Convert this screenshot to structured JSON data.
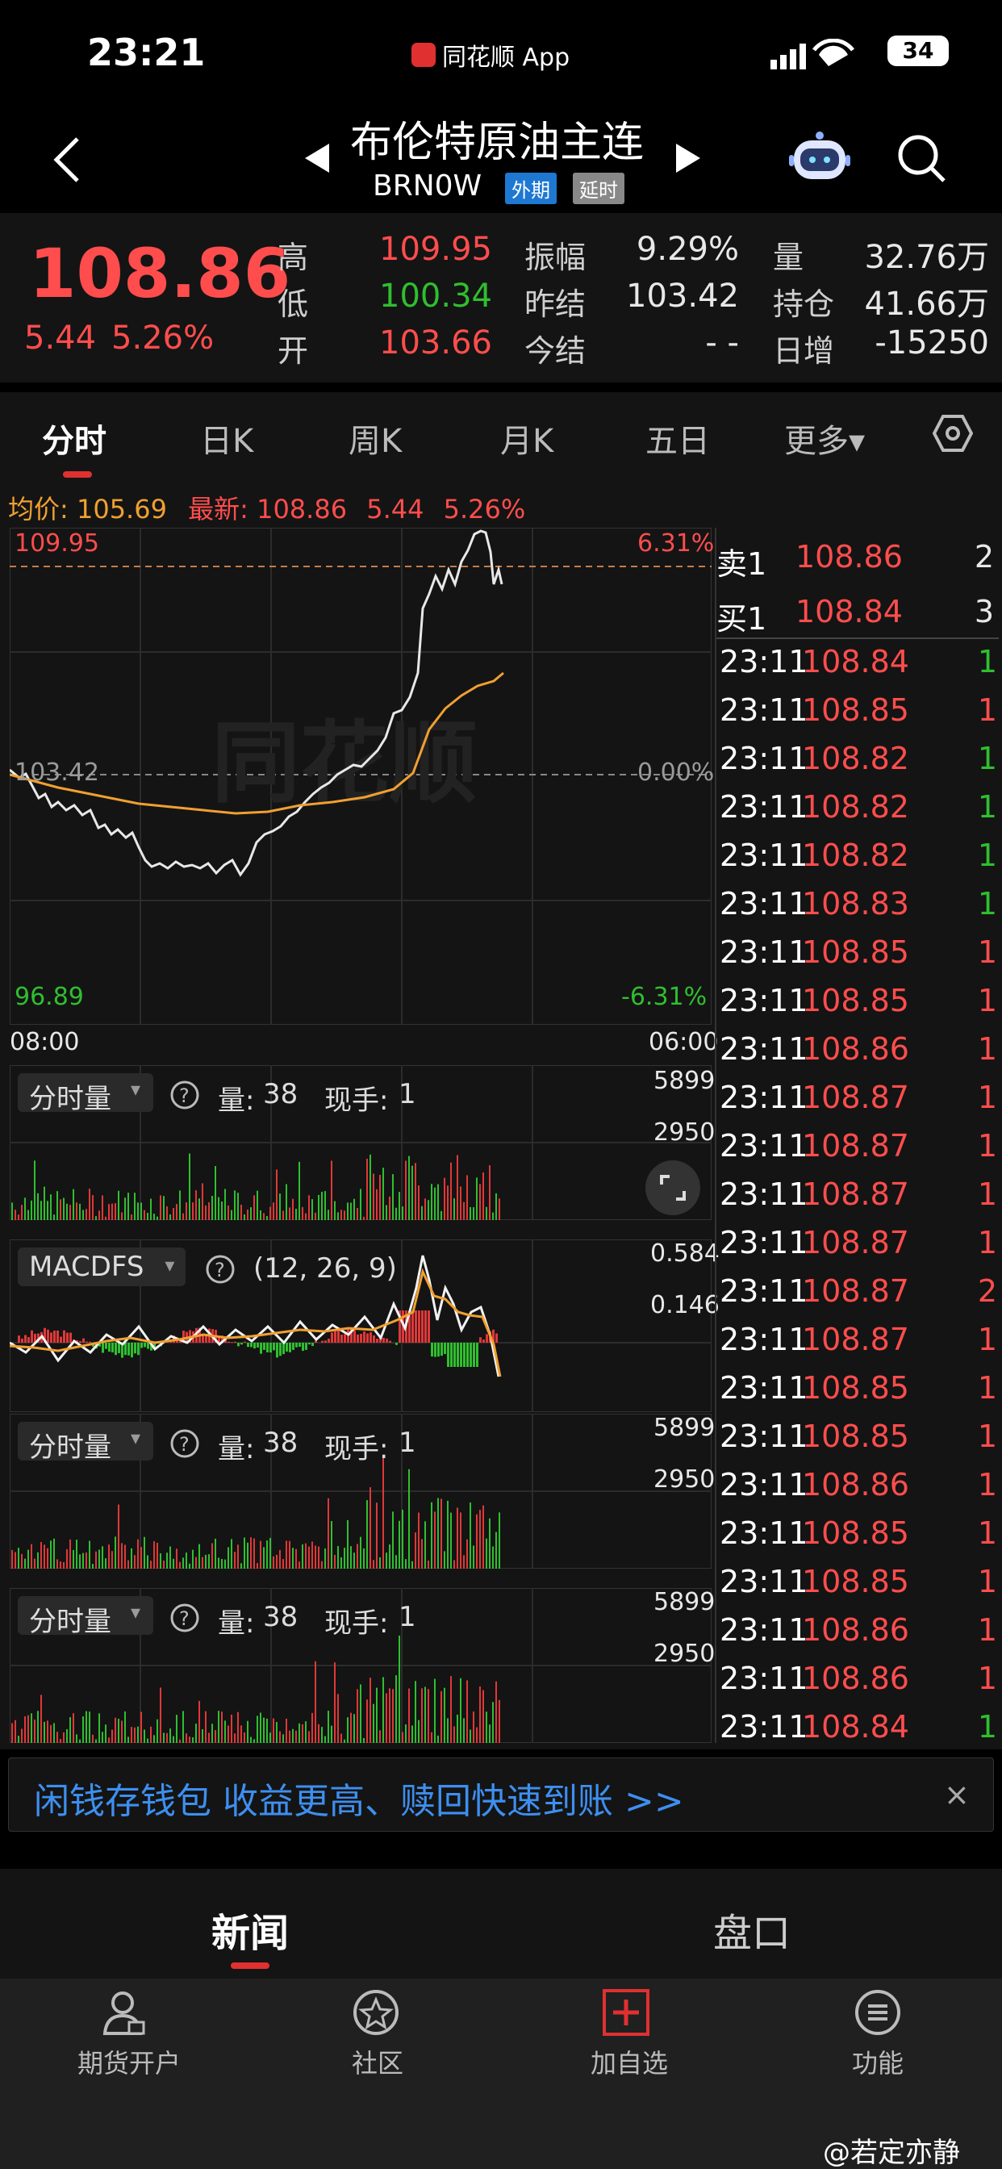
{
  "status_bar": {
    "time": "23:21",
    "app_name": "同花顺 App",
    "battery": "34"
  },
  "header": {
    "title": "布伦特原油主连",
    "code": "BRN0W",
    "tags": [
      "外期",
      "延时"
    ]
  },
  "quote": {
    "price": "108.86",
    "change": "5.44",
    "change_pct": "5.26%",
    "fields": [
      {
        "label": "高",
        "value": "109.95",
        "color": "red"
      },
      {
        "label": "低",
        "value": "100.34",
        "color": "green"
      },
      {
        "label": "开",
        "value": "103.66",
        "color": "red"
      },
      {
        "label": "振幅",
        "value": "9.29%",
        "color": "white"
      },
      {
        "label": "昨结",
        "value": "103.42",
        "color": "white"
      },
      {
        "label": "今结",
        "value": "- -",
        "color": "white"
      },
      {
        "label": "量",
        "value": "32.76万",
        "color": "white"
      },
      {
        "label": "持仓",
        "value": "41.66万",
        "color": "white"
      },
      {
        "label": "日增",
        "value": "-15250",
        "color": "white"
      }
    ]
  },
  "tabs": [
    "分时",
    "日K",
    "周K",
    "月K",
    "五日",
    "更多▾"
  ],
  "summary": {
    "avg_label": "均价:",
    "avg_value": "105.69",
    "latest_label": "最新:",
    "latest_value": "108.86",
    "latest_change": "5.44",
    "latest_pct": "5.26%"
  },
  "price_chart": {
    "high": "109.95",
    "high_pct": "6.31%",
    "base": "103.42",
    "base_pct": "0.00%",
    "low": "96.89",
    "low_pct": "-6.31%",
    "start_time": "08:00",
    "end_time": "06:00",
    "watermark": "同花顺"
  },
  "volume_panels": [
    {
      "name": "分时量",
      "vol_label": "量:",
      "vol": "38",
      "hand_label": "现手:",
      "hand": "1",
      "top": "5899",
      "mid": "2950"
    },
    {
      "name": "分时量",
      "vol_label": "量:",
      "vol": "38",
      "hand_label": "现手:",
      "hand": "1",
      "top": "5899",
      "mid": "2950"
    },
    {
      "name": "分时量",
      "vol_label": "量:",
      "vol": "38",
      "hand_label": "现手:",
      "hand": "1",
      "top": "5899",
      "mid": "2950"
    }
  ],
  "macd": {
    "name": "MACDFS",
    "params": "(12, 26, 9)",
    "top": "0.584",
    "mid": "0.146"
  },
  "order_book": {
    "sell_label": "卖1",
    "sell_price": "108.86",
    "sell_vol": "2",
    "buy_label": "买1",
    "buy_price": "108.84",
    "buy_vol": "3"
  },
  "trades": [
    {
      "time": "23:11",
      "price": "108.84",
      "vol": "1",
      "dir": "green"
    },
    {
      "time": "23:11",
      "price": "108.85",
      "vol": "1",
      "dir": "red"
    },
    {
      "time": "23:11",
      "price": "108.82",
      "vol": "1",
      "dir": "green"
    },
    {
      "time": "23:11",
      "price": "108.82",
      "vol": "1",
      "dir": "green"
    },
    {
      "time": "23:11",
      "price": "108.82",
      "vol": "1",
      "dir": "green"
    },
    {
      "time": "23:11",
      "price": "108.83",
      "vol": "1",
      "dir": "green"
    },
    {
      "time": "23:11",
      "price": "108.85",
      "vol": "1",
      "dir": "red"
    },
    {
      "time": "23:11",
      "price": "108.85",
      "vol": "1",
      "dir": "red"
    },
    {
      "time": "23:11",
      "price": "108.86",
      "vol": "1",
      "dir": "red"
    },
    {
      "time": "23:11",
      "price": "108.87",
      "vol": "1",
      "dir": "red"
    },
    {
      "time": "23:11",
      "price": "108.87",
      "vol": "1",
      "dir": "red"
    },
    {
      "time": "23:11",
      "price": "108.87",
      "vol": "1",
      "dir": "red"
    },
    {
      "time": "23:11",
      "price": "108.87",
      "vol": "1",
      "dir": "red"
    },
    {
      "time": "23:11",
      "price": "108.87",
      "vol": "2",
      "dir": "red"
    },
    {
      "time": "23:11",
      "price": "108.87",
      "vol": "1",
      "dir": "red"
    },
    {
      "time": "23:11",
      "price": "108.85",
      "vol": "1",
      "dir": "red"
    },
    {
      "time": "23:11",
      "price": "108.85",
      "vol": "1",
      "dir": "red"
    },
    {
      "time": "23:11",
      "price": "108.86",
      "vol": "1",
      "dir": "red"
    },
    {
      "time": "23:11",
      "price": "108.85",
      "vol": "1",
      "dir": "red"
    },
    {
      "time": "23:11",
      "price": "108.85",
      "vol": "1",
      "dir": "red"
    },
    {
      "time": "23:11",
      "price": "108.86",
      "vol": "1",
      "dir": "red"
    },
    {
      "time": "23:11",
      "price": "108.86",
      "vol": "1",
      "dir": "red"
    },
    {
      "time": "23:11",
      "price": "108.84",
      "vol": "1",
      "dir": "green"
    }
  ],
  "banner": {
    "text": "闲钱存钱包 收益更高、赎回快速到账 >>",
    "close": "×"
  },
  "lower_tabs": [
    "新闻",
    "盘口"
  ],
  "bottom_nav": [
    "期货开户",
    "社区",
    "加自选",
    "功能"
  ],
  "watermark": "@若定亦静",
  "colors": {
    "up": "#ff4d4d",
    "down": "#2fbf2f",
    "avg": "#f0a030",
    "accent": "#e03030",
    "link": "#3d8ff0"
  }
}
